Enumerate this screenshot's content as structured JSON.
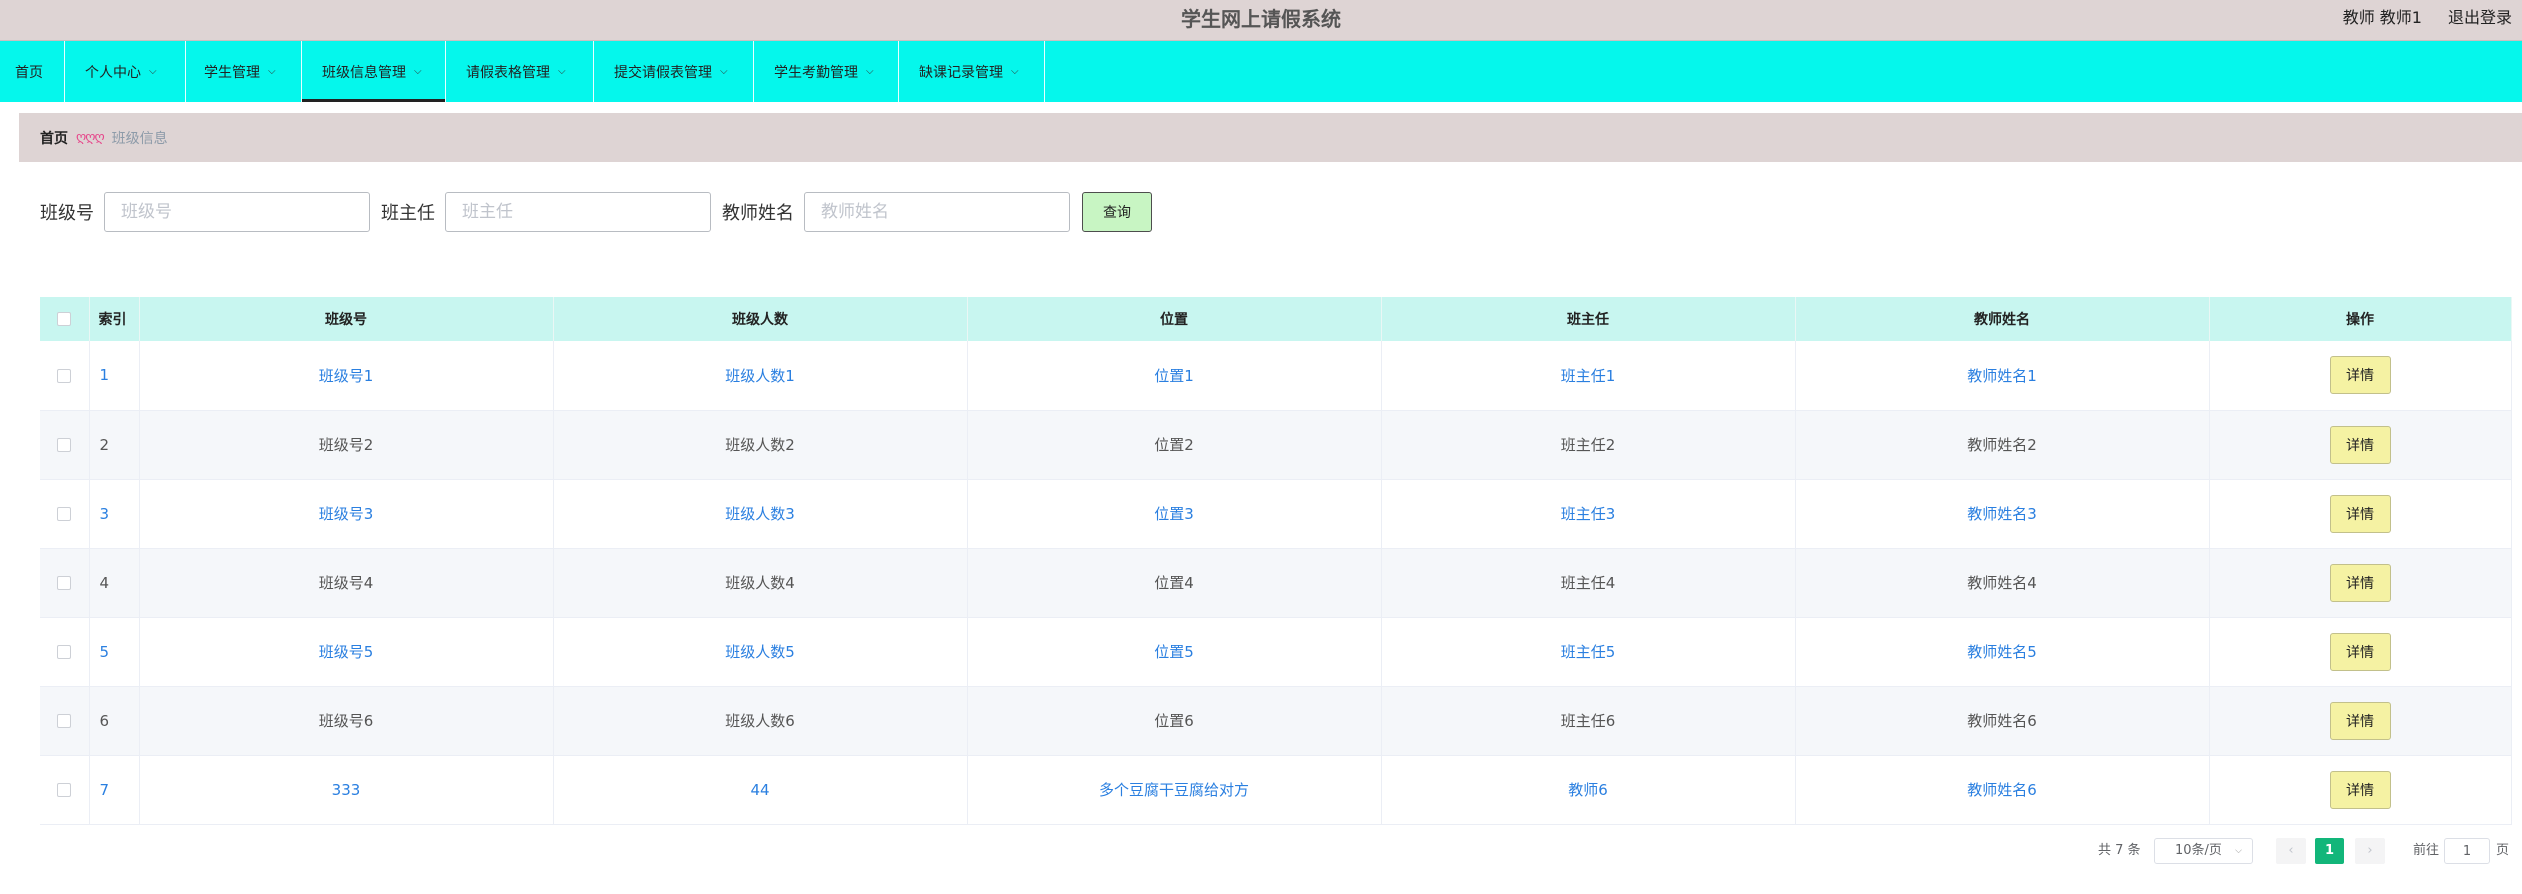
{
  "header": {
    "title": "学生网上请假系统",
    "user": "教师 教师1",
    "logout": "退出登录"
  },
  "nav": {
    "items": [
      {
        "label": "首页",
        "dropdown": false
      },
      {
        "label": "个人中心",
        "dropdown": true
      },
      {
        "label": "学生管理",
        "dropdown": true
      },
      {
        "label": "班级信息管理",
        "dropdown": true,
        "active": true
      },
      {
        "label": "请假表格管理",
        "dropdown": true
      },
      {
        "label": "提交请假表管理",
        "dropdown": true
      },
      {
        "label": "学生考勤管理",
        "dropdown": true
      },
      {
        "label": "缺课记录管理",
        "dropdown": true
      }
    ]
  },
  "breadcrumb": {
    "home": "首页",
    "separator": "ღღღ",
    "current": "班级信息"
  },
  "search": {
    "class_no_label": "班级号",
    "class_no_placeholder": "班级号",
    "head_teacher_label": "班主任",
    "head_teacher_placeholder": "班主任",
    "teacher_name_label": "教师姓名",
    "teacher_name_placeholder": "教师姓名",
    "query_button": "查询"
  },
  "table": {
    "headers": {
      "index": "索引",
      "class_no": "班级号",
      "class_size": "班级人数",
      "location": "位置",
      "head_teacher": "班主任",
      "teacher_name": "教师姓名",
      "action": "操作"
    },
    "action_label": "详情",
    "rows": [
      {
        "index": "1",
        "class_no": "班级号1",
        "class_size": "班级人数1",
        "location": "位置1",
        "head_teacher": "班主任1",
        "teacher_name": "教师姓名1"
      },
      {
        "index": "2",
        "class_no": "班级号2",
        "class_size": "班级人数2",
        "location": "位置2",
        "head_teacher": "班主任2",
        "teacher_name": "教师姓名2"
      },
      {
        "index": "3",
        "class_no": "班级号3",
        "class_size": "班级人数3",
        "location": "位置3",
        "head_teacher": "班主任3",
        "teacher_name": "教师姓名3"
      },
      {
        "index": "4",
        "class_no": "班级号4",
        "class_size": "班级人数4",
        "location": "位置4",
        "head_teacher": "班主任4",
        "teacher_name": "教师姓名4"
      },
      {
        "index": "5",
        "class_no": "班级号5",
        "class_size": "班级人数5",
        "location": "位置5",
        "head_teacher": "班主任5",
        "teacher_name": "教师姓名5"
      },
      {
        "index": "6",
        "class_no": "班级号6",
        "class_size": "班级人数6",
        "location": "位置6",
        "head_teacher": "班主任6",
        "teacher_name": "教师姓名6"
      },
      {
        "index": "7",
        "class_no": "333",
        "class_size": "44",
        "location": "多个豆腐干豆腐给对方",
        "head_teacher": "教师6",
        "teacher_name": "教师姓名6"
      }
    ]
  },
  "pagination": {
    "total": "共 7 条",
    "page_size": "10条/页",
    "prev": "‹",
    "current_page": "1",
    "next": "›",
    "goto_label": "前往",
    "goto_value": "1",
    "goto_unit": "页"
  },
  "colors": {
    "navbar": "#05f7ec",
    "topbar": "#ded4d4",
    "table_header": "#c8f6f0",
    "link": "#2a7fe0",
    "detail_button": "#f5f2a3",
    "query_button": "#c8f5c3",
    "active_page": "#12b67a"
  }
}
